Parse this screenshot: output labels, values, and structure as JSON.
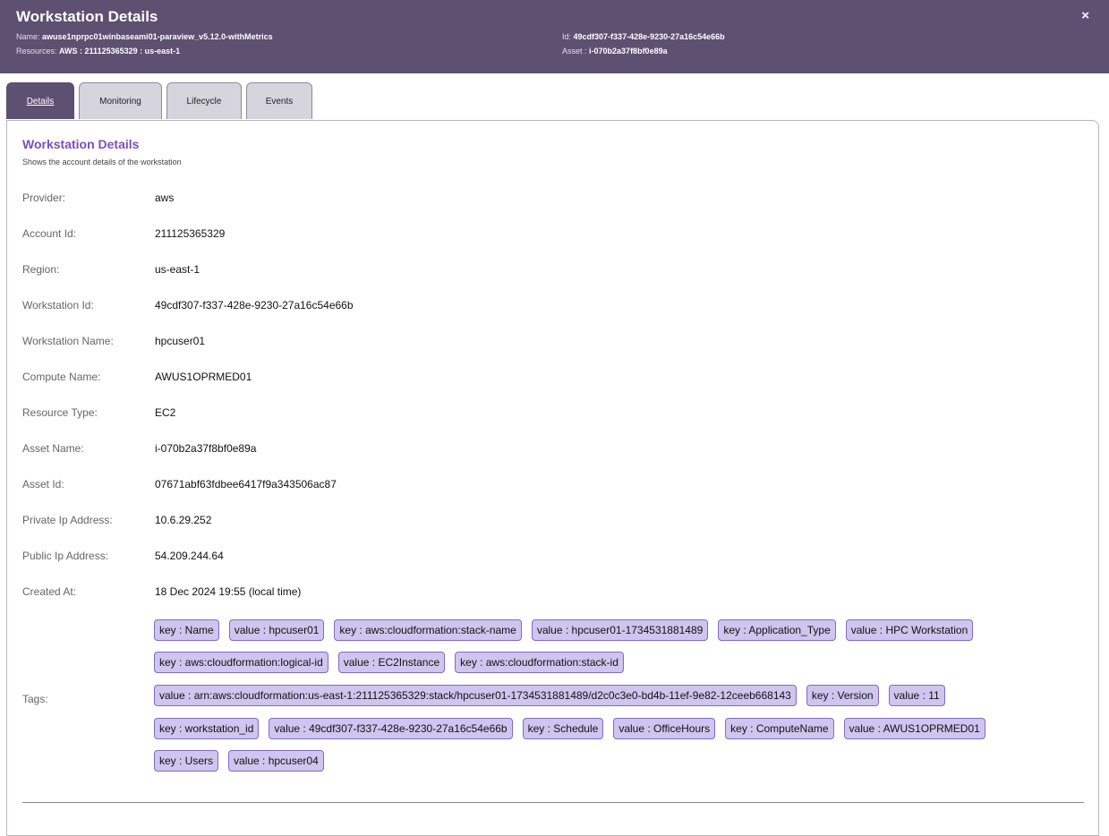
{
  "header": {
    "title": "Workstation Details",
    "close": "×",
    "name_label": "Name:",
    "name_value": "awuse1nprpc01winbaseami01-paraview_v5.12.0-withMetrics",
    "resources_label": "Resources:",
    "resources_value": "AWS : 211125365329 : us-east-1",
    "id_label": "Id:",
    "id_value": "49cdf307-f337-428e-9230-27a16c54e66b",
    "asset_label": "Asset :",
    "asset_value": "i-070b2a37f8bf0e89a"
  },
  "tabs": [
    {
      "label": "Details",
      "active": true
    },
    {
      "label": "Monitoring",
      "active": false
    },
    {
      "label": "Lifecycle",
      "active": false
    },
    {
      "label": "Events",
      "active": false
    }
  ],
  "section": {
    "title": "Workstation Details",
    "subtitle": "Shows the account details of the workstation"
  },
  "details": [
    {
      "label": "Provider:",
      "value": "aws"
    },
    {
      "label": "Account Id:",
      "value": "211125365329"
    },
    {
      "label": "Region:",
      "value": "us-east-1"
    },
    {
      "label": "Workstation Id:",
      "value": "49cdf307-f337-428e-9230-27a16c54e66b"
    },
    {
      "label": "Workstation Name:",
      "value": "hpcuser01"
    },
    {
      "label": "Compute Name:",
      "value": "AWUS1OPRMED01"
    },
    {
      "label": "Resource Type:",
      "value": "EC2"
    },
    {
      "label": "Asset Name:",
      "value": "i-070b2a37f8bf0e89a"
    },
    {
      "label": "Asset Id:",
      "value": "07671abf63fdbee6417f9a343506ac87"
    },
    {
      "label": "Private Ip Address:",
      "value": "10.6.29.252"
    },
    {
      "label": "Public Ip Address:",
      "value": "54.209.244.64"
    },
    {
      "label": "Created At:",
      "value": "18 Dec 2024 19:55  (local time)"
    }
  ],
  "tags_label": "Tags:",
  "tag_rows": [
    [
      "key : Name",
      "value : hpcuser01",
      "key : aws:cloudformation:stack-name",
      "value : hpcuser01-1734531881489",
      "key : Application_Type",
      "value : HPC Workstation"
    ],
    [
      "key : aws:cloudformation:logical-id",
      "value : EC2Instance",
      "key : aws:cloudformation:stack-id"
    ],
    [
      "value : arn:aws:cloudformation:us-east-1:211125365329:stack/hpcuser01-1734531881489/d2c0c3e0-bd4b-11ef-9e82-12ceeb668143",
      "key : Version",
      "value : 11"
    ],
    [
      "key : workstation_id",
      "value : 49cdf307-f337-428e-9230-27a16c54e66b",
      "key : Schedule",
      "value : OfficeHours",
      "key : ComputeName",
      "value : AWUS1OPRMED01"
    ],
    [
      "key : Users",
      "value : hpcuser04"
    ]
  ]
}
